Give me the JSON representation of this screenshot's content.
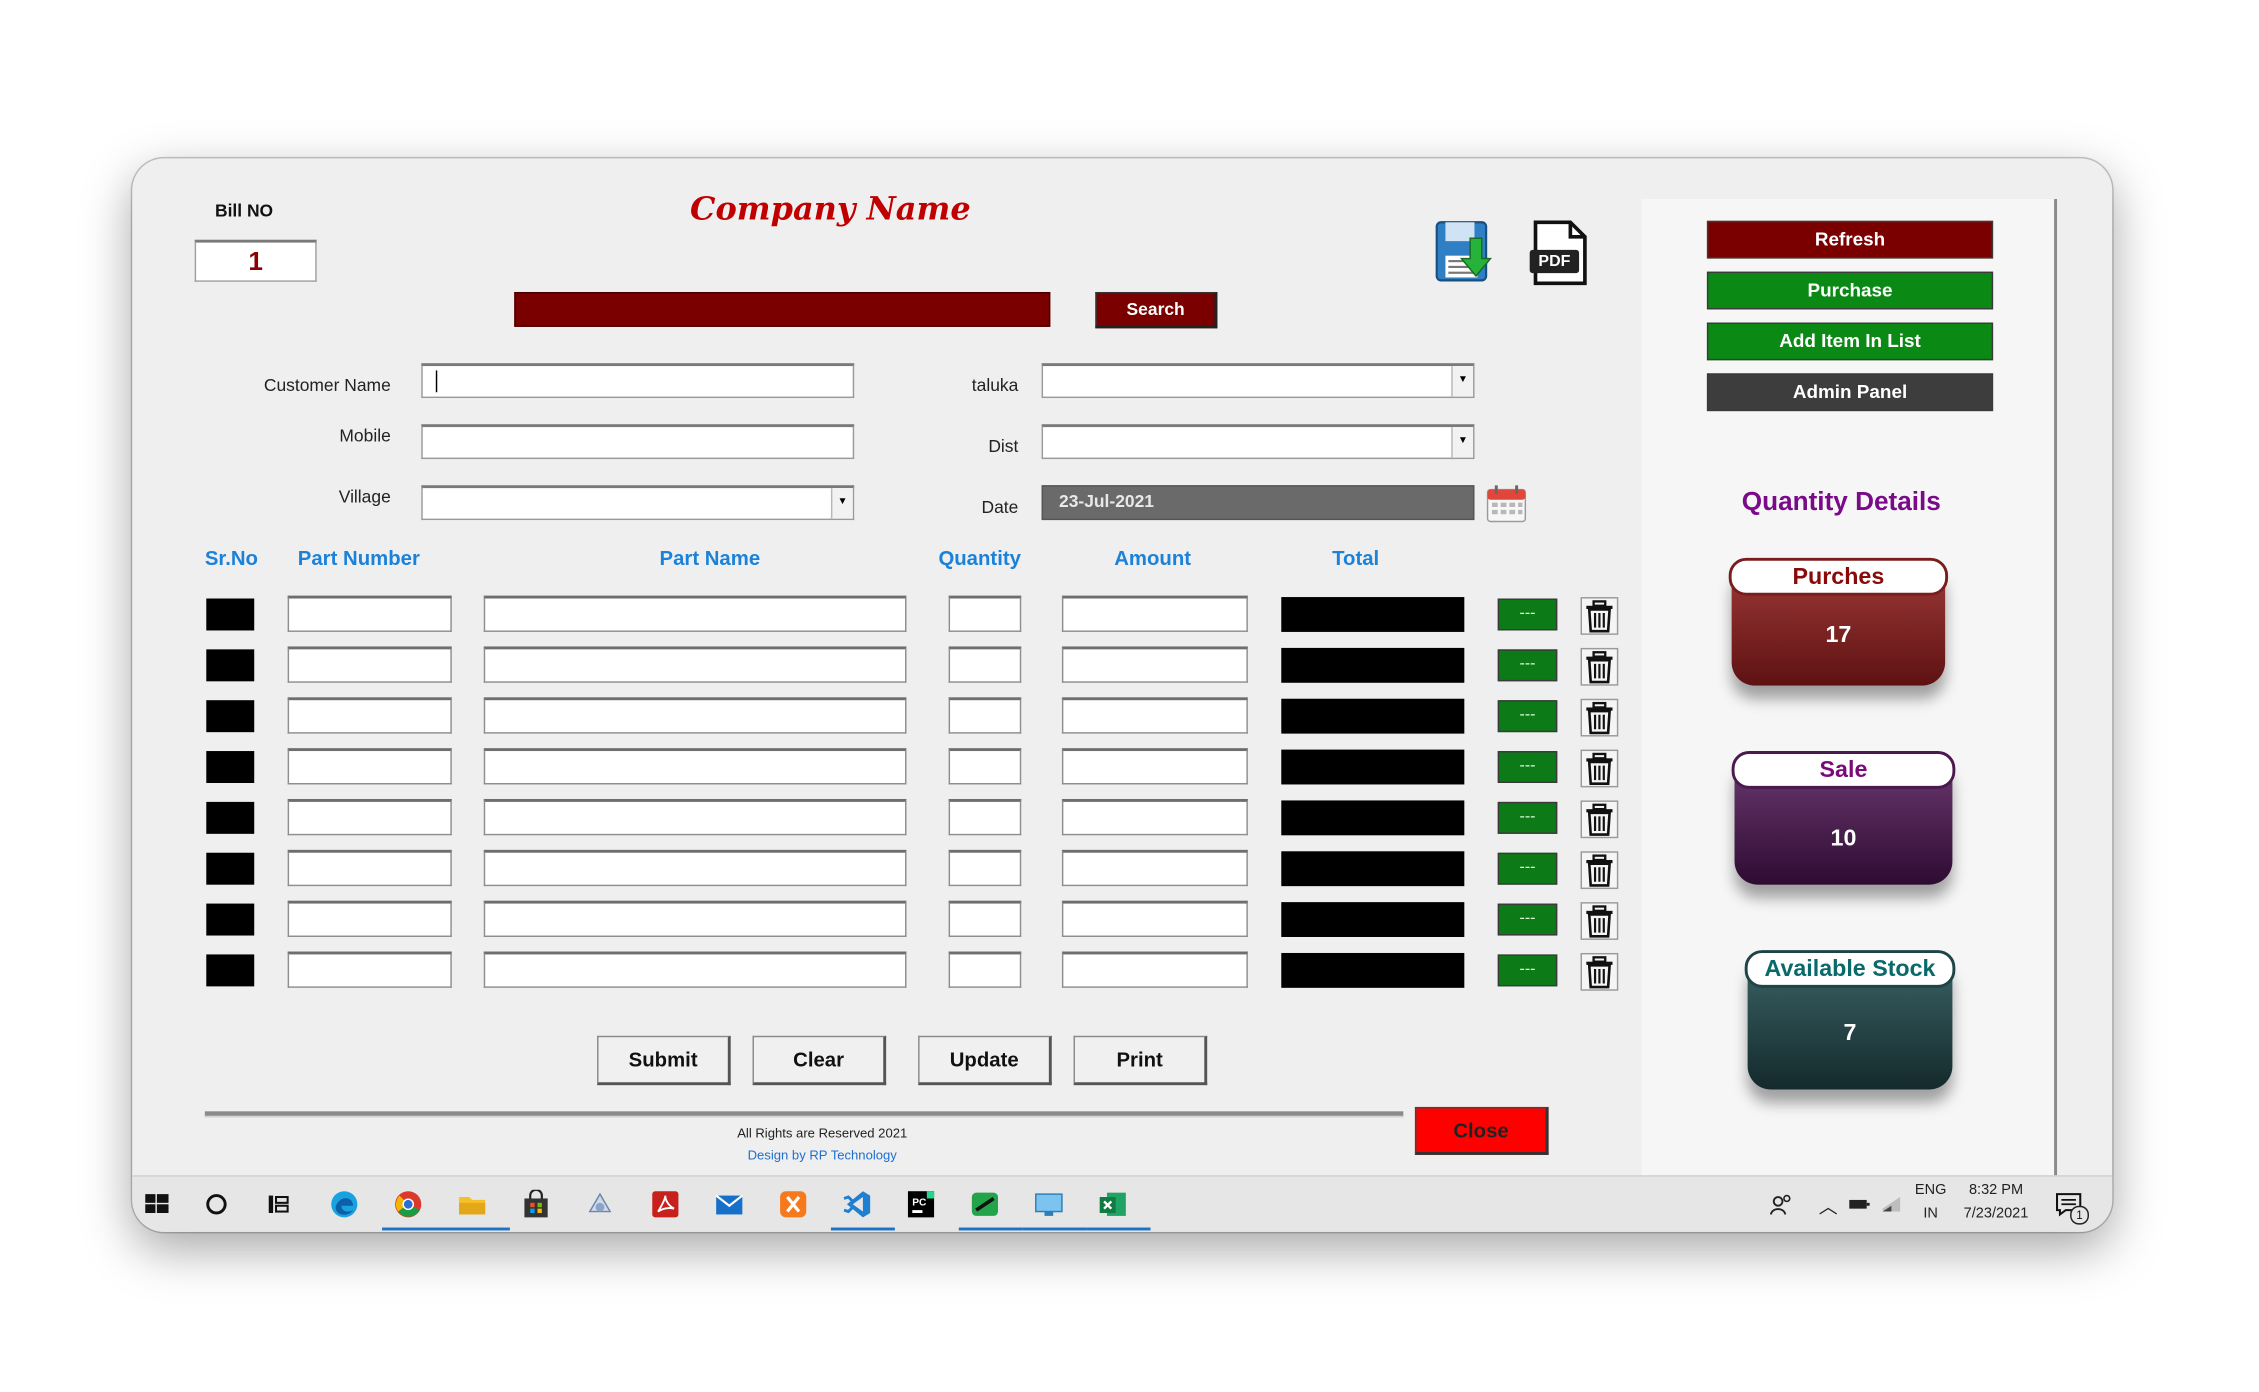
{
  "header": {
    "bill_no_label": "Bill NO",
    "bill_no_value": "1",
    "company_name": "Company Name",
    "search_label": "Search",
    "pdf_label": "PDF"
  },
  "form": {
    "customer_name_label": "Customer Name",
    "mobile_label": "Mobile",
    "village_label": "Village",
    "taluka_label": "taluka",
    "dist_label": "Dist",
    "date_label": "Date",
    "date_value": "23-Jul-2021"
  },
  "table": {
    "columns": [
      "Sr.No",
      "Part Number",
      "Part Name",
      "Quantity",
      "Amount",
      "Total"
    ],
    "row_count": 8,
    "row_button_label": "---"
  },
  "actions": {
    "submit": "Submit",
    "clear": "Clear",
    "update": "Update",
    "print": "Print",
    "close": "Close"
  },
  "footer": {
    "rights": "All Rights are Reserved 2021",
    "design": "Design by RP Technology"
  },
  "side_panel": {
    "buttons": [
      {
        "label": "Refresh",
        "color": "#7a0000"
      },
      {
        "label": "Purchase",
        "color": "#0a8a14"
      },
      {
        "label": "Add Item In List",
        "color": "#0a8a14"
      },
      {
        "label": "Admin Panel",
        "color": "#3d3d3d"
      }
    ],
    "quantity_title": "Quantity Details",
    "cards": [
      {
        "label": "Purches",
        "value": "17",
        "label_color": "#8a0a0a",
        "color": "#7a1d1d"
      },
      {
        "label": "Sale",
        "value": "10",
        "label_color": "#7a0a7a",
        "color": "#4a1a4e"
      },
      {
        "label": "Available Stock",
        "value": "7",
        "label_color": "#0a6a6a",
        "color": "#1f4448"
      }
    ]
  },
  "taskbar": {
    "lang_top": "ENG",
    "lang_bottom": "IN",
    "time": "8:32 PM",
    "date": "7/23/2021",
    "notification_count": "1",
    "apps": [
      "windows-icon",
      "search-icon",
      "task-view-icon",
      "edge-icon",
      "chrome-icon",
      "file-explorer-icon",
      "store-icon",
      "app-icon",
      "acrobat-icon",
      "mail-icon",
      "xampp-icon",
      "vscode-icon",
      "pycharm-icon",
      "green-app-icon",
      "remote-desktop-icon",
      "excel-icon"
    ]
  },
  "colors": {
    "accent_red": "#c00000",
    "header_blue": "#1c82d9",
    "search_bar": "#7a0000",
    "close_red": "#ff0000",
    "quantity_title": "#7a0a8a"
  }
}
